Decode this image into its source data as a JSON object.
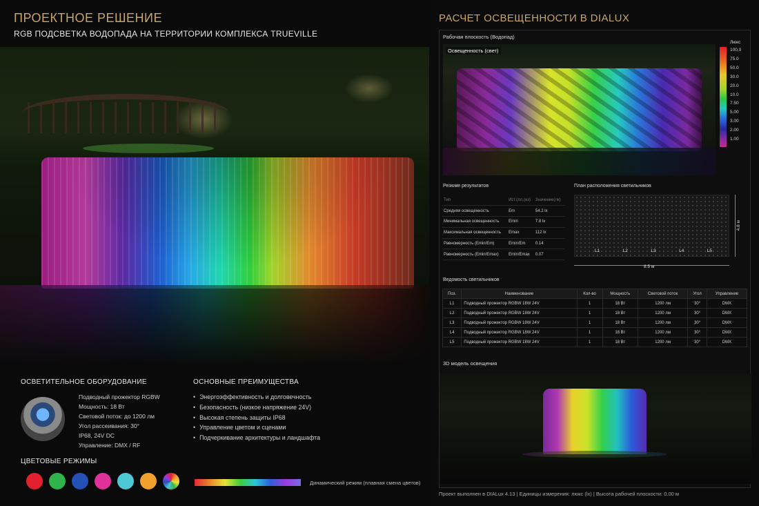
{
  "left": {
    "title": "ПРОЕКТНОЕ РЕШЕНИЕ",
    "subtitle": "RGB ПОДСВЕТКА ВОДОПАДА НА ТЕРРИТОРИИ КОМПЛЕКСА TRUEVILLE",
    "equipment_heading": "ОСВЕТИТЕЛЬНОЕ ОБОРУДОВАНИЕ",
    "equipment_lines": [
      "Подводный прожектор RGBW",
      "Мощность: 18 Вт",
      "Световой поток: до 1200 лм",
      "Угол рассеивания: 30°",
      "IP68, 24V DC",
      "Управление: DMX / RF"
    ],
    "advantages_heading": "ОСНОВНЫЕ ПРЕИМУЩЕСТВА",
    "advantages": [
      "Энергоэффективность и долговечность",
      "Безопасность (низкое напряжение 24V)",
      "Высокая степень защиты IP68",
      "Управление цветом и сценами",
      "Подчеркивание архитектуры и ландшафта"
    ],
    "color_modes_heading": "ЦВЕТОВЫЕ РЕЖИМЫ",
    "color_swatches": [
      "#e3202f",
      "#2fb34a",
      "#2451b5",
      "#e0309a",
      "#4fc8d6",
      "#f0a02c",
      "conic"
    ],
    "dynamic_label": "Динамический режим (плавная смена цветов)"
  },
  "right": {
    "title": "РАСЧЕТ ОСВЕЩЕННОСТИ В DIALUX",
    "workplane_label": "Рабочая плоскость (Водопад)",
    "render_label": "Освещенность (свет)",
    "legend_unit": "Люкс",
    "legend_values": [
      "100,0",
      "75.0",
      "50.0",
      "30.0",
      "20.0",
      "10.0",
      "7.50",
      "5.00",
      "3.00",
      "2.00",
      "1.00"
    ],
    "results_heading": "Резюме результатов",
    "results_header": [
      "Тип",
      "Ист.(лл.(из)",
      "Значение(лк)"
    ],
    "results_rows": [
      [
        "Средняя освещенность",
        "Em",
        "54.2 lx"
      ],
      [
        "Минимальная освещенность",
        "Emin",
        "7.8 lx"
      ],
      [
        "Максимальная освещенность",
        "Emax",
        "112 lx"
      ],
      [
        "Равномерность (Emin/Em)",
        "Emin/Em",
        "0.14"
      ],
      [
        "Равномерность (Emin/Emax)",
        "Emin/Emax",
        "0.07"
      ]
    ],
    "plan_heading": "План расположения светильников",
    "plan_labels": [
      "L1",
      "L2",
      "L3",
      "L4",
      "L5"
    ],
    "plan_width": "8.5 м",
    "plan_height": "4.8 м",
    "luminaires_heading": "Ведомость светильников",
    "luminaires_header": [
      "Поз.",
      "Наименование",
      "Кол-во",
      "Мощность",
      "Световой поток",
      "Угол",
      "Управление"
    ],
    "luminaires_rows": [
      [
        "L1",
        "Подводный прожектор RGBW 18W 24V",
        "1",
        "18 Вт",
        "1200 лм",
        "30°",
        "DMX"
      ],
      [
        "L2",
        "Подводный прожектор RGBW 18W 24V",
        "1",
        "18 Вт",
        "1200 лм",
        "30°",
        "DMX"
      ],
      [
        "L3",
        "Подводный прожектор RGBW 18W 24V",
        "1",
        "18 Вт",
        "1200 лм",
        "30°",
        "DMX"
      ],
      [
        "L4",
        "Подводный прожектор RGBW 18W 24V",
        "1",
        "18 Вт",
        "1200 лм",
        "30°",
        "DMX"
      ],
      [
        "L5",
        "Подводный прожектор RGBW 18W 24V",
        "1",
        "18 Вт",
        "1200 лм",
        "30°",
        "DMX"
      ]
    ],
    "model3d_heading": "3D модель освещения",
    "footer": "Проект выполнен в DIALux 4.13  |  Единицы измерения: люкс (lx)  |  Высота рабочей плоскости: 0.00 м"
  }
}
